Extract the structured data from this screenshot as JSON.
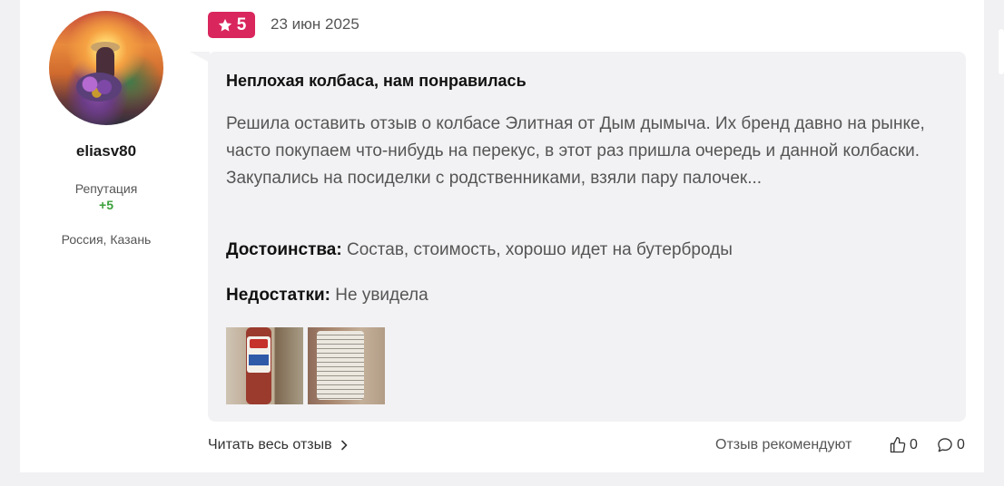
{
  "user": {
    "username": "eliasv80",
    "reputation_label": "Репутация",
    "reputation_value": "+5",
    "location": "Россия, Казань"
  },
  "review": {
    "rating": "5",
    "date": "23 июн 2025",
    "title": "Неплохая колбаса, нам понравилась",
    "text": "Решила оставить отзыв о колбасе Элитная от Дым дымыча. Их бренд давно на рынке, часто покупаем что-нибудь на перекус, в этот раз пришла очередь и данной колбаски. Закупались на посиделки с родственниками, взяли пару палочек...",
    "pros_label": "Достоинства:",
    "pros_value": "Состав, стоимость, хорошо идет на бутерброды",
    "cons_label": "Недостатки:",
    "cons_value": "Не увидела"
  },
  "footer": {
    "read_more": "Читать весь отзыв",
    "recommend": "Отзыв рекомендуют",
    "likes": "0",
    "comments": "0"
  },
  "colors": {
    "rating_badge": "#d9265d",
    "reputation_positive": "#3aa13a",
    "bubble_bg": "#f2f2f4"
  },
  "icons": [
    "star-icon",
    "chevron-right-icon",
    "thumbs-up-icon",
    "comment-icon"
  ]
}
